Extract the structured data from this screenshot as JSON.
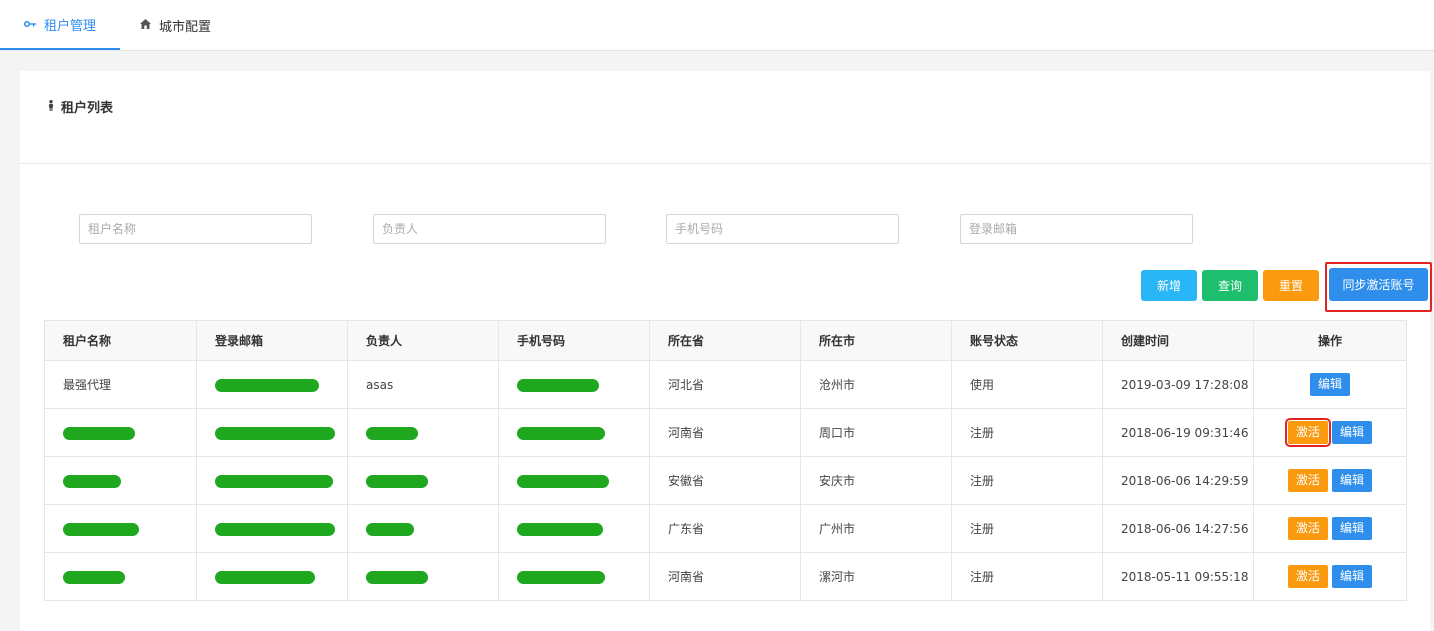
{
  "tabs": [
    {
      "label": "租户管理",
      "icon": "key-icon",
      "active": true
    },
    {
      "label": "城市配置",
      "icon": "home-icon",
      "active": false
    }
  ],
  "panel": {
    "title": "租户列表",
    "icon": "person-icon"
  },
  "filters": {
    "tenant_name": {
      "placeholder": "租户名称",
      "value": ""
    },
    "owner": {
      "placeholder": "负责人",
      "value": ""
    },
    "phone": {
      "placeholder": "手机号码",
      "value": ""
    },
    "email": {
      "placeholder": "登录邮箱",
      "value": ""
    }
  },
  "buttons": {
    "new": "新增",
    "query": "查询",
    "reset": "重置",
    "sync": "同步激活账号"
  },
  "table": {
    "columns": [
      "租户名称",
      "登录邮箱",
      "负责人",
      "手机号码",
      "所在省",
      "所在市",
      "账号状态",
      "创建时间",
      "操作"
    ],
    "rows": [
      {
        "name": "最强代理",
        "email": "",
        "owner": "asas",
        "phone": "",
        "province": "河北省",
        "city": "沧州市",
        "status": "使用",
        "created": "2019-03-09 17:28:08",
        "actions": [
          "编辑"
        ]
      },
      {
        "name": "",
        "email": "",
        "owner": "",
        "phone": "",
        "province": "河南省",
        "city": "周口市",
        "status": "注册",
        "created": "2018-06-19 09:31:46",
        "actions": [
          "激活",
          "编辑"
        ]
      },
      {
        "name": "",
        "email": "",
        "owner": "",
        "phone": "",
        "province": "安徽省",
        "city": "安庆市",
        "status": "注册",
        "created": "2018-06-06 14:29:59",
        "actions": [
          "激活",
          "编辑"
        ]
      },
      {
        "name": "",
        "email": "",
        "owner": "",
        "phone": "",
        "province": "广东省",
        "city": "广州市",
        "status": "注册",
        "created": "2018-06-06 14:27:56",
        "actions": [
          "激活",
          "编辑"
        ]
      },
      {
        "name": "",
        "email": "",
        "owner": "",
        "phone": "",
        "province": "河南省",
        "city": "漯河市",
        "status": "注册",
        "created": "2018-05-11 09:55:18",
        "actions": [
          "激活",
          "编辑"
        ]
      }
    ]
  },
  "colors": {
    "primary": "#2f8eeb",
    "accent_cyan": "#29b6f6",
    "success": "#1dbe6e",
    "warning": "#fb9a0e",
    "highlight_outline": "#e02424",
    "redaction": "#1fa81f"
  }
}
